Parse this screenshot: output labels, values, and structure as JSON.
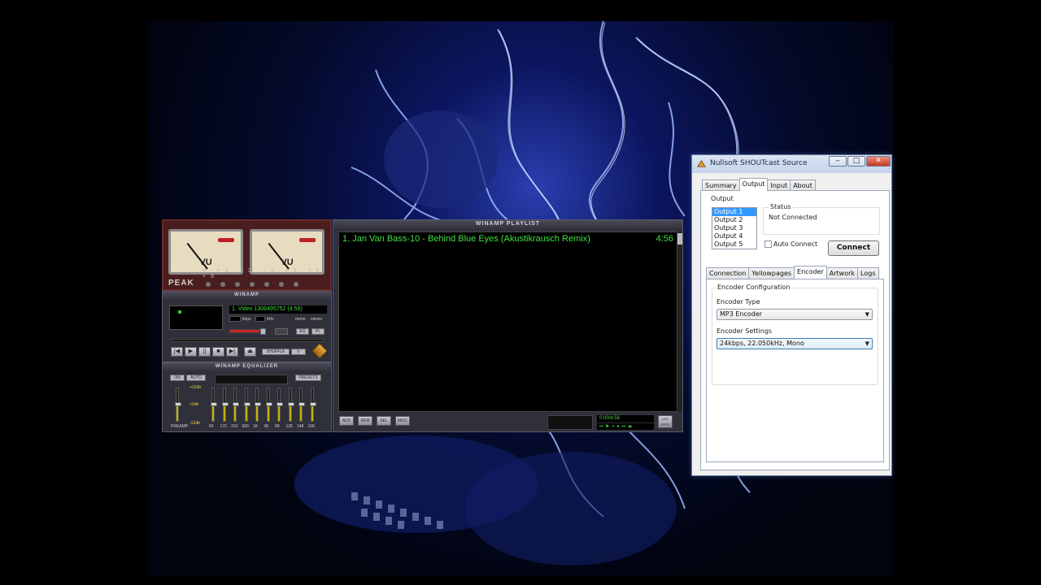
{
  "winamp": {
    "vu_label": "VU",
    "peak_label": "PEAK",
    "peak_scale": "0 +1 +2 +3 +4 +6 +8",
    "main_title": "WINAMP",
    "song_ticker": "1. Video 1308495752 (4:56)",
    "kbps_label": "kbps",
    "khz_label": "kHz",
    "mono_label": "mono",
    "stereo_label": "stereo",
    "shuffle_label": "SHUFFLE",
    "eq_label": "EQ",
    "pl_label": "PL",
    "transport": [
      "|◀",
      "▶",
      "||",
      "■",
      "▶|",
      "⏏"
    ],
    "eq_title": "WINAMP EQUALIZER",
    "eq_on": "ON",
    "eq_auto": "AUTO",
    "eq_presets": "PRESETS",
    "eq_db_top": "+12db",
    "eq_db_mid": "+0db",
    "eq_db_bottom": "-12db",
    "eq_preamp_label": "PREAMP",
    "eq_freqs": [
      "60",
      "170",
      "310",
      "600",
      "1K",
      "3K",
      "6K",
      "12K",
      "14K",
      "16K"
    ],
    "playlist_title": "WINAMP PLAYLIST",
    "playlist_items": [
      {
        "title": "1. Jan Van Bass-10 - Behind Blue Eyes (Akustikrausch Remix)",
        "duration": "4:56"
      }
    ],
    "pl_buttons": [
      "ADD",
      "REM",
      "SEL",
      "MISC"
    ],
    "pl_time": "0:00/4:56",
    "pl_mini_controls": "⏮ ▶ ⏸ ⏹ ⏭ ⏏",
    "pl_list_opts": "LIST OPTS"
  },
  "shoutcast": {
    "title": "Nullsoft SHOUTcast Source",
    "window_buttons": {
      "minimize": "‒",
      "maximize": "□",
      "close": "✕"
    },
    "top_tabs": [
      "Summary",
      "Output",
      "Input",
      "About"
    ],
    "top_tab_active": "Output",
    "output_group_title": "Output",
    "outputs": [
      "Output 1",
      "Output 2",
      "Output 3",
      "Output 4",
      "Output 5"
    ],
    "status_title": "Status",
    "status_value": "Not Connected",
    "auto_connect_label": "Auto Connect",
    "connect_button": "Connect",
    "sub_tabs": [
      "Connection",
      "Yellowpages",
      "Encoder",
      "Artwork",
      "Logs"
    ],
    "sub_tab_active": "Encoder",
    "encoder_config_title": "Encoder Configuration",
    "encoder_type_label": "Encoder Type",
    "encoder_type_value": "MP3 Encoder",
    "encoder_settings_label": "Encoder Settings",
    "encoder_settings_value": "24kbps, 22.050kHz, Mono"
  },
  "colors": {
    "winamp_green": "#3ee03e",
    "wallpaper_blue": "#2a3fb0",
    "selection_blue": "#3399ff"
  }
}
